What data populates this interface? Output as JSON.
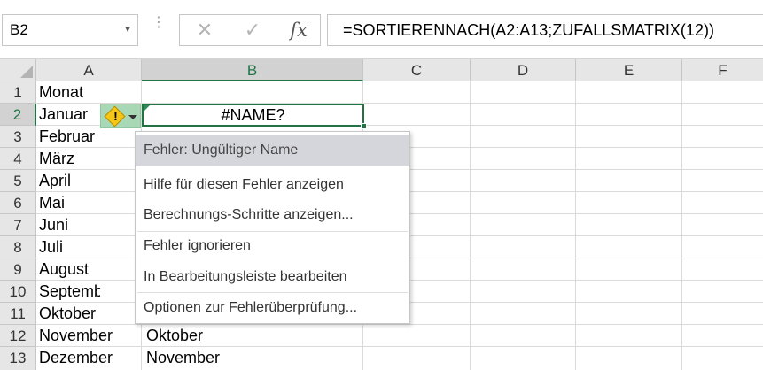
{
  "formula_bar": {
    "name_box": "B2",
    "grip": "⋮",
    "cancel_icon": "✕",
    "enter_icon": "✓",
    "fx_label": "fx",
    "formula": "=SORTIERENNACH(A2:A13;ZUFALLSMATRIX(12))"
  },
  "columns": [
    "A",
    "B",
    "C",
    "D",
    "E",
    "F"
  ],
  "rows": [
    "1",
    "2",
    "3",
    "4",
    "5",
    "6",
    "7",
    "8",
    "9",
    "10",
    "11",
    "12",
    "13"
  ],
  "cells": {
    "A": [
      "Monat",
      "Januar",
      "Februar",
      "März",
      "April",
      "Mai",
      "Juni",
      "Juli",
      "August",
      "September",
      "Oktober",
      "November",
      "Dezember"
    ],
    "B12": "Oktober",
    "B13": "November"
  },
  "active_cell": {
    "ref": "B2",
    "value": "#NAME?"
  },
  "error_tag": {
    "glyph": "!"
  },
  "error_menu": {
    "header": "Fehler: Ungültiger Name",
    "items": [
      "Hilfe für diesen Fehler anzeigen",
      "Berechnungs-Schritte anzeigen...",
      "Fehler ignorieren",
      "In Bearbeitungsleiste bearbeiten",
      "Optionen zur Fehlerüberprüfung..."
    ]
  },
  "colors": {
    "accent_green": "#217346",
    "warning_yellow": "#f5c518",
    "menu_highlight": "#d5d5dc"
  }
}
